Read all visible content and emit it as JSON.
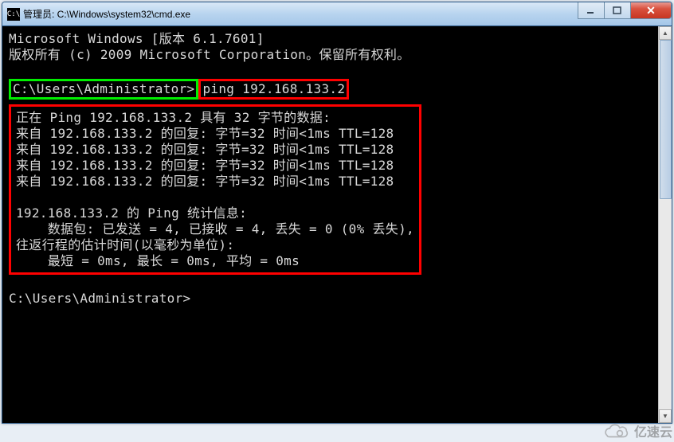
{
  "window": {
    "icon_label": "C:\\",
    "title": "管理员: C:\\Windows\\system32\\cmd.exe"
  },
  "terminal": {
    "header1": "Microsoft Windows [版本 6.1.7601]",
    "header2": "版权所有 (c) 2009 Microsoft Corporation。保留所有权利。",
    "prompt": "C:\\Users\\Administrator>",
    "command": "ping 192.168.133.2",
    "output": {
      "pinging": "正在 Ping 192.168.133.2 具有 32 字节的数据:",
      "reply1": "来自 192.168.133.2 的回复: 字节=32 时间<1ms TTL=128",
      "reply2": "来自 192.168.133.2 的回复: 字节=32 时间<1ms TTL=128",
      "reply3": "来自 192.168.133.2 的回复: 字节=32 时间<1ms TTL=128",
      "reply4": "来自 192.168.133.2 的回复: 字节=32 时间<1ms TTL=128",
      "blank1": "",
      "stats_header": "192.168.133.2 的 Ping 统计信息:",
      "stats_packets": "    数据包: 已发送 = 4, 已接收 = 4, 丢失 = 0 (0% 丢失),",
      "stats_rtt_header": "往返行程的估计时间(以毫秒为单位):",
      "stats_rtt": "    最短 = 0ms, 最长 = 0ms, 平均 = 0ms"
    },
    "final_prompt": "C:\\Users\\Administrator>"
  },
  "watermark": {
    "text": "亿速云"
  }
}
